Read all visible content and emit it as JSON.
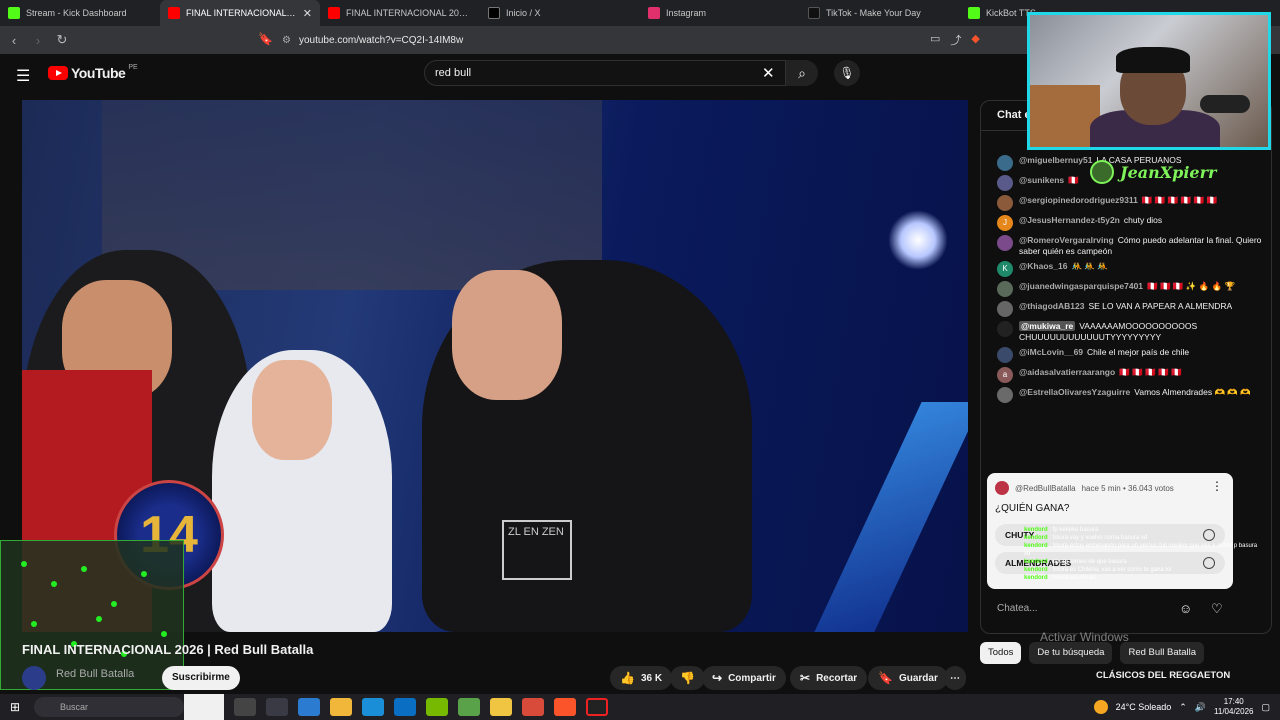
{
  "tabs": [
    {
      "title": "Stream - Kick Dashboard",
      "icon": "kick-icon",
      "color": "#53fc18"
    },
    {
      "title": "FINAL INTERNACIONAL 2026",
      "icon": "youtube-icon",
      "color": "#ff0000",
      "active": true
    },
    {
      "title": "FINAL INTERNACIONAL 2026 | Red",
      "icon": "youtube-icon",
      "color": "#ff0000"
    },
    {
      "title": "Inicio / X",
      "icon": "x-icon",
      "color": "#000000"
    },
    {
      "title": "Instagram",
      "icon": "instagram-icon",
      "color": "#e1306c"
    },
    {
      "title": "TikTok - Make Your Day",
      "icon": "tiktok-icon",
      "color": "#111111"
    },
    {
      "title": "KickBot TTS",
      "icon": "kickbot-icon",
      "color": "#53fc18"
    }
  ],
  "address": {
    "url": "youtube.com/watch?v=CQ2I-14IM8w"
  },
  "youtube": {
    "logo_text": "YouTube",
    "country": "PE",
    "search_value": "red bull"
  },
  "video": {
    "title": "FINAL INTERNACIONAL 2026 | Red Bull Batalla",
    "channel": "Red Bull Batalla",
    "medal_number": "14",
    "shirt_text": "ZL EN ZEN",
    "subscribe": "Suscribirme",
    "likes": "36 K",
    "share": "Compartir",
    "clip": "Recortar",
    "save": "Guardar"
  },
  "streamer": {
    "name": "JeanXpierr"
  },
  "chat": {
    "header": "Chat en directo",
    "messages": [
      {
        "author": "@miguelbernuy51",
        "text": "LA CASA PERUANOS",
        "color": "#3a6b8a",
        "initial": ""
      },
      {
        "author": "@sunikens",
        "text": "🇵🇪",
        "color": "#5a5a8a",
        "initial": ""
      },
      {
        "author": "@sergiopinedorodriguez9311",
        "text": "🇵🇪 🇵🇪 🇵🇪 🇵🇪 🇵🇪 🇵🇪",
        "color": "#8a5a3a",
        "initial": ""
      },
      {
        "author": "@JesusHernandez-t5y2n",
        "text": "chuty dios",
        "color": "#e6871c",
        "initial": "J"
      },
      {
        "author": "@RomeroVergaralrving",
        "text": "Cómo puedo adelantar la final. Quiero saber quién es campeón",
        "color": "#7a4a8a",
        "initial": ""
      },
      {
        "author": "@Khaos_16",
        "text": "🤼 🤼 🤼",
        "color": "#1f8a6a",
        "initial": "K"
      },
      {
        "author": "@juanedwingasparquispe7401",
        "text": "🇵🇪 🇵🇪 🇵🇪 ✨ 🔥 🔥 🏆",
        "color": "#5a6a5a",
        "initial": ""
      },
      {
        "author": "@thiagodAB123",
        "text": "SE LO VAN A PAPEAR A ALMENDRA",
        "color": "#666666",
        "initial": ""
      },
      {
        "author": "@mukiwa_re",
        "text": "VAAAAAAMOOOOOOOOOOS CHUUUUUUUUUUUUTYYYYYYYYY",
        "color": "#222222",
        "initial": "",
        "mod": true
      },
      {
        "author": "@iMcLovin__69",
        "text": "Chile el mejor país de chile",
        "color": "#3a4a6a",
        "initial": ""
      },
      {
        "author": "@aidasalvatierraarango",
        "text": "🇵🇪 🇵🇪 🇵🇪 🇵🇪 🇵🇪",
        "color": "#8a5a5a",
        "initial": "a"
      },
      {
        "author": "@EstrellaOlivaresYzaguirre",
        "text": "Vamos Almendrades 🫶 🫶 🫶",
        "color": "#6a6a6a",
        "initial": ""
      }
    ],
    "poll": {
      "channel": "@RedBullBatalla",
      "meta": "hace 5 min • 36.043 votos",
      "question": "¿QUIÉN GANA?",
      "options": [
        "CHUTY",
        "ALMENDRADES"
      ]
    },
    "input_placeholder": "Chatea..."
  },
  "kick_chat": [
    {
      "user": "kendord",
      "text": "fp kekeke basura"
    },
    {
      "user": "kendord",
      "text": "tmura vay y vuelvo noma basura xd"
    },
    {
      "user": "kendord",
      "text": "tmura estoy entrenando para un versus full invoker que vas a saber p basura xd"
    },
    {
      "user": "kendord",
      "text": "tmura torneo de que basura"
    },
    {
      "user": "kendord",
      "text": "tmura es Chilena, vas a ver como te gana lol"
    },
    {
      "user": "kendord",
      "text": "tmura eso no es"
    }
  ],
  "watermark": "Activar Windows",
  "chips": {
    "all": "Todos",
    "search": "De tu búsqueda",
    "channel": "Red Bull Batalla"
  },
  "related_title": "CLÁSICOS DEL REGGAETON",
  "taskbar": {
    "search": "Buscar",
    "weather": "24°C  Soleado",
    "time": "17:40",
    "date": "11/04/2026"
  }
}
